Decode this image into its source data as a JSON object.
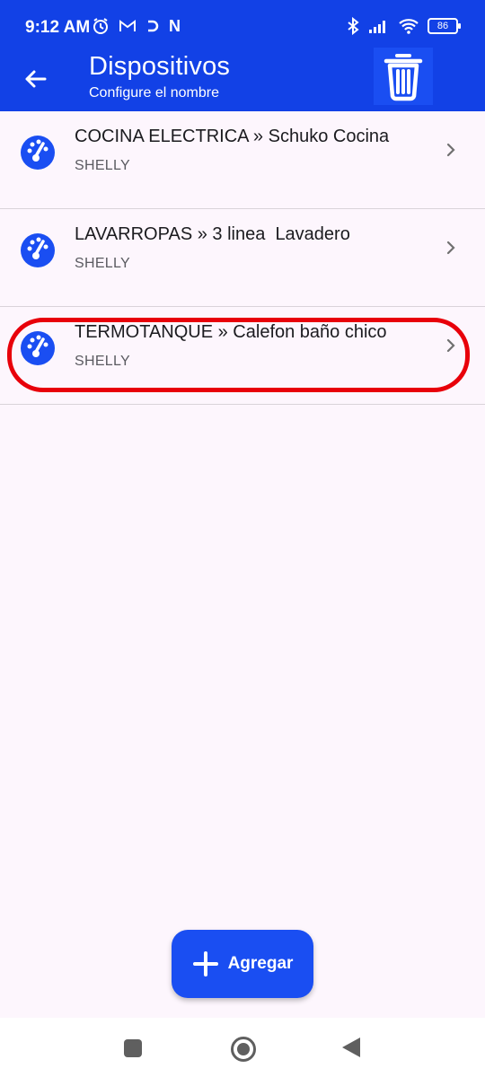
{
  "status_bar": {
    "time": "9:12 AM",
    "left_icons": [
      "alarm-icon",
      "gmail-icon",
      "app-icon",
      "n-icon"
    ],
    "n_glyph": "N",
    "right_icons": [
      "bluetooth-icon",
      "signal-icon",
      "wifi-icon",
      "battery-icon"
    ],
    "battery": "86"
  },
  "app_bar": {
    "title": "Dispositivos",
    "subtitle": "Configure el nombre",
    "back_icon": "arrow-left-icon",
    "trash_icon": "trash-icon"
  },
  "devices": [
    {
      "title": "COCINA ELECTRICA » Schuko Cocina",
      "subtitle": "SHELLY",
      "icon": "gauge-icon"
    },
    {
      "title": "LAVARROPAS » 3 linea  Lavadero",
      "subtitle": "SHELLY",
      "icon": "gauge-icon"
    },
    {
      "title": "TERMOTANQUE » Calefon baño chico",
      "subtitle": "SHELLY",
      "icon": "gauge-icon"
    }
  ],
  "fab": {
    "label": "Agregar",
    "icon": "plus-icon"
  },
  "colors": {
    "primary": "#1241e6",
    "fab": "#1a4ef2",
    "background": "#fdf6fd",
    "highlight": "#e8000a"
  }
}
